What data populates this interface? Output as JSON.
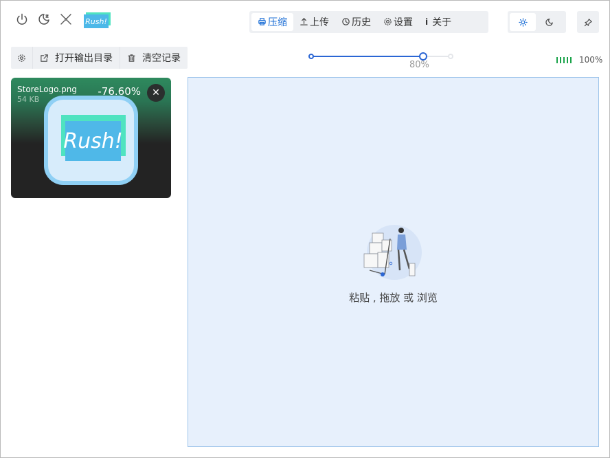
{
  "window": {
    "top_icons": [
      "power-icon",
      "sleep-moon-icon",
      "expand-arrows-icon"
    ]
  },
  "logo": {
    "text": "Rush!"
  },
  "tabs": [
    {
      "label": "压缩",
      "icon": "printer-icon",
      "active": true
    },
    {
      "label": "上传",
      "icon": "upload-icon",
      "active": false
    },
    {
      "label": "历史",
      "icon": "history-icon",
      "active": false
    },
    {
      "label": "设置",
      "icon": "gear-icon",
      "active": false
    },
    {
      "label": "关于",
      "icon": "info-icon",
      "active": false
    }
  ],
  "theme": {
    "options": [
      "sun-icon",
      "moon-icon"
    ],
    "active": "sun-icon"
  },
  "pin": {
    "icon": "pin-icon"
  },
  "toolbar": {
    "settings_icon": "gear-icon",
    "open_output_label": "打开输出目录",
    "clear_records_label": "清空记录"
  },
  "quality": {
    "value_percent": 80,
    "label": "80%"
  },
  "battery": {
    "percent": 100,
    "label": "100%"
  },
  "files": [
    {
      "name": "StoreLogo.png",
      "size": "54 KB",
      "ratio": "-76.60%",
      "icon_text": "Rush!"
    }
  ],
  "drop_zone": {
    "hint": "粘贴 , 拖放 或 浏览"
  },
  "colors": {
    "accent": "#2b66d4",
    "drop_bg": "#e7f0fc",
    "battery": "#1aa34a"
  }
}
